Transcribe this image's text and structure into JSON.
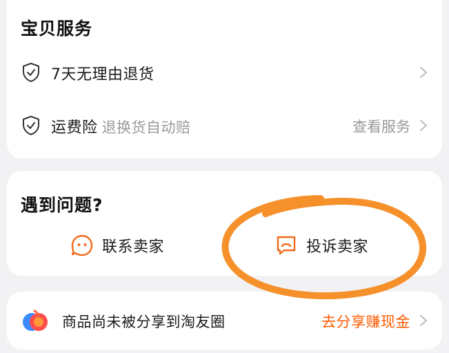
{
  "service": {
    "title": "宝贝服务",
    "rows": [
      {
        "label": "7天无理由退货",
        "sub": "",
        "right": ""
      },
      {
        "label": "运费险",
        "sub": "退换货自动赔",
        "right": "查看服务"
      }
    ]
  },
  "problem": {
    "title": "遇到问题?",
    "contact_label": "联系卖家",
    "complain_label": "投诉卖家"
  },
  "share": {
    "text": "商品尚未被分享到淘友圈",
    "action": "去分享赚现金"
  },
  "colors": {
    "accent": "#ff5a00",
    "icon_orange": "#f26a1b",
    "muted_text": "#9a9a9a",
    "annotation": "#f5902a"
  },
  "icons": {
    "shield": "shield-check-icon",
    "chevron": "chevron-right-icon",
    "contact": "smiley-chat-icon",
    "complain": "complaint-chat-icon",
    "share_logo": "taoyouquan-logo-icon"
  }
}
